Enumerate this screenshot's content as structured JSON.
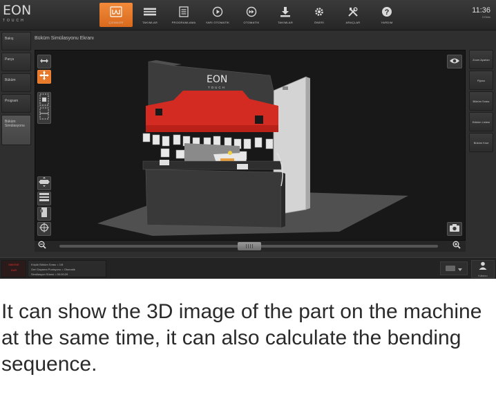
{
  "app": {
    "logo_text": "EON",
    "logo_sub": "TOUCH",
    "clock_time": "11:36",
    "clock_date": "3 Ekim"
  },
  "nav": [
    {
      "label": "ÇIZIMLER",
      "icon": "bend-shape-icon",
      "active": true
    },
    {
      "label": "TAKIMLAR",
      "icon": "tool-stack-icon",
      "active": false
    },
    {
      "label": "PROGRAMLAMA",
      "icon": "list-doc-icon",
      "active": false
    },
    {
      "label": "YARI OTOMATİK",
      "icon": "play-circle-icon",
      "active": false
    },
    {
      "label": "OTOMATİK",
      "icon": "fast-forward-icon",
      "active": false
    },
    {
      "label": "TAKIMLAR",
      "icon": "download-tray-icon",
      "active": false
    },
    {
      "label": "ÖNERİ",
      "icon": "gear-icon",
      "active": false
    },
    {
      "label": "ARAÇLAR",
      "icon": "wrench-icon",
      "active": false
    },
    {
      "label": "YARDIM",
      "icon": "help-icon",
      "active": false
    }
  ],
  "left_menu": [
    {
      "label": "Bakış"
    },
    {
      "label": "Parça"
    },
    {
      "label": "Büküm"
    },
    {
      "label": "Program"
    },
    {
      "label": "Büküm Simülasyonu",
      "active": true
    }
  ],
  "panel_title": "Büküm Simülasyonu Ekranı",
  "machine_logo": {
    "brand": "EON",
    "sub": "TOUCH"
  },
  "right_menu": [
    {
      "label": "Zoom Ayarları"
    },
    {
      "label": "Pğoso"
    },
    {
      "label": "Büküm Sırası"
    },
    {
      "label": "Büküm Listesi"
    },
    {
      "label": "Büküm Kısıt"
    }
  ],
  "status_led": {
    "line1": "MAKİNE",
    "line2": "DUR"
  },
  "status_info": [
    "Küçük Büküm Sırası = 1/8",
    "Geri Dayama Pozisyonu = Otomatik",
    "Simülasyon Süresi = 00:00:29"
  ],
  "bottom_user_label": "Kullanıcı",
  "caption": "It can show the 3D image of the part on the machine at the same time, it can also calculate the bending sequence.",
  "colors": {
    "accent": "#e8782a",
    "machine_red": "#d32a22",
    "machine_body": "#3b3b3b",
    "floor": "#4f4f4f",
    "guard": "#d8d8d8"
  }
}
